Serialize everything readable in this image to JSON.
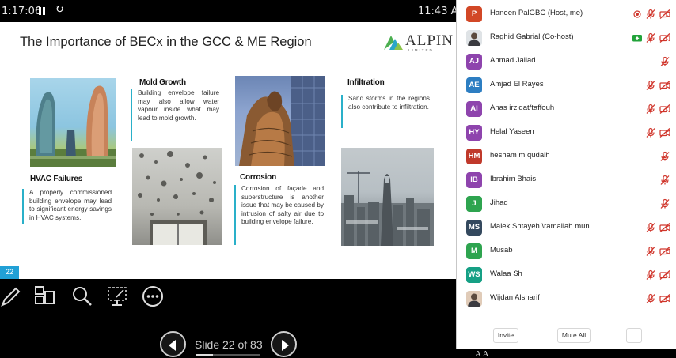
{
  "topbar": {
    "elapsed_time": "1:17:06",
    "reset_glyph": "↻",
    "clock": "11:43 AM"
  },
  "slide": {
    "title": "The Importance of BECx in the GCC & ME Region",
    "logo_text": "ALPIN",
    "logo_subtext": "LIMITED",
    "slide_number": "22",
    "sections": {
      "mold": {
        "heading": "Mold Growth",
        "text": "Building envelope failure may also allow water vapour inside what may lead to mold growth."
      },
      "infiltration": {
        "heading": "Infiltration",
        "text": "Sand storms in the regions also contribute to infiltration."
      },
      "hvac": {
        "heading": "HVAC Failures",
        "text": "A properly commissioned building envelope may lead to significant energy savings in HVAC systems."
      },
      "corrosion": {
        "heading": "Corrosion",
        "text": "Corrosion of façade and superstructure is another issue that may be caused by intrusion of salty air due to building envelope failure."
      }
    }
  },
  "toolbar": {
    "tools": [
      "pen-icon",
      "slides-grid-icon",
      "magnifier-icon",
      "laser-pointer-icon",
      "more-options-icon"
    ],
    "slide_counter": "Slide 22 of 83",
    "slide_progress": 0.265
  },
  "participants": {
    "items": [
      {
        "name": "Haneen PalGBC (Host, me)",
        "initials": "P",
        "color": "#d24726",
        "status": "recording"
      },
      {
        "name": "Raghid Gabrial (Co-host)",
        "initials": "",
        "color": "#dfe3e6",
        "status": "sharing",
        "photo": true
      },
      {
        "name": "Ahmad Jallad",
        "initials": "AJ",
        "color": "#8e44ad",
        "status": "mic-only"
      },
      {
        "name": "Amjad El Rayes",
        "initials": "AE",
        "color": "#2d7ec2",
        "status": "muted"
      },
      {
        "name": "Anas irziqat/taffouh",
        "initials": "AI",
        "color": "#8e44ad",
        "status": "muted"
      },
      {
        "name": "Helal Yaseen",
        "initials": "HY",
        "color": "#8e44ad",
        "status": "muted"
      },
      {
        "name": "hesham m qudaih",
        "initials": "HM",
        "color": "#c0392b",
        "status": "mic-only"
      },
      {
        "name": "Ibrahim Bhais",
        "initials": "IB",
        "color": "#8e44ad",
        "status": "mic-only"
      },
      {
        "name": "Jihad",
        "initials": "J",
        "color": "#2ea44f",
        "status": "mic-only"
      },
      {
        "name": "Malek Shtayeh \\ramallah mun.",
        "initials": "MS",
        "color": "#34495e",
        "status": "muted"
      },
      {
        "name": "Musab",
        "initials": "M",
        "color": "#2ea44f",
        "status": "muted"
      },
      {
        "name": "Walaa Sh",
        "initials": "WS",
        "color": "#16a085",
        "status": "muted"
      },
      {
        "name": "Wijdan Alsharif",
        "initials": "",
        "color": "#e0cbb8",
        "status": "muted",
        "photo": true
      }
    ],
    "invite_label": "Invite",
    "mute_all_label": "Mute All",
    "more_label": "..."
  },
  "colors": {
    "accent": "#2ab0c9",
    "slide_number_bg": "#21a0d6",
    "muted_red": "#d0352b",
    "share_green": "#22a33a"
  },
  "background_text": "A A"
}
